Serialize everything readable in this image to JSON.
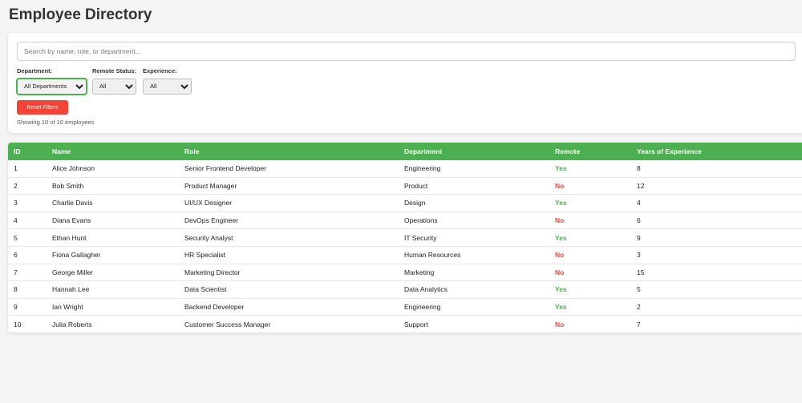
{
  "page": {
    "title": "Employee Directory"
  },
  "search": {
    "placeholder": "Search by name, role, or department..."
  },
  "filters": {
    "department": {
      "label": "Department:",
      "selected": "All Departments"
    },
    "remote": {
      "label": "Remote Status:",
      "selected": "All"
    },
    "experience": {
      "label": "Experience:",
      "selected": "All"
    }
  },
  "reset_button": {
    "label": "Reset Filters"
  },
  "results_count": "Showing 10 of 10 employees",
  "colors": {
    "accent": "#4caf50",
    "danger": "#f44336"
  },
  "table": {
    "columns": [
      "ID",
      "Name",
      "Role",
      "Department",
      "Remote",
      "Years of Experience"
    ],
    "rows": [
      {
        "id": "1",
        "name": "Alice Johnson",
        "role": "Senior Frontend Developer",
        "department": "Engineering",
        "remote": "Yes",
        "experience": "8"
      },
      {
        "id": "2",
        "name": "Bob Smith",
        "role": "Product Manager",
        "department": "Product",
        "remote": "No",
        "experience": "12"
      },
      {
        "id": "3",
        "name": "Charlie Davis",
        "role": "UI/UX Designer",
        "department": "Design",
        "remote": "Yes",
        "experience": "4"
      },
      {
        "id": "4",
        "name": "Diana Evans",
        "role": "DevOps Engineer",
        "department": "Operations",
        "remote": "No",
        "experience": "6"
      },
      {
        "id": "5",
        "name": "Ethan Hunt",
        "role": "Security Analyst",
        "department": "IT Security",
        "remote": "Yes",
        "experience": "9"
      },
      {
        "id": "6",
        "name": "Fiona Gallagher",
        "role": "HR Specialist",
        "department": "Human Resources",
        "remote": "No",
        "experience": "3"
      },
      {
        "id": "7",
        "name": "George Miller",
        "role": "Marketing Director",
        "department": "Marketing",
        "remote": "No",
        "experience": "15"
      },
      {
        "id": "8",
        "name": "Hannah Lee",
        "role": "Data Scientist",
        "department": "Data Analytics",
        "remote": "Yes",
        "experience": "5"
      },
      {
        "id": "9",
        "name": "Ian Wright",
        "role": "Backend Developer",
        "department": "Engineering",
        "remote": "Yes",
        "experience": "2"
      },
      {
        "id": "10",
        "name": "Julia Roberts",
        "role": "Customer Success Manager",
        "department": "Support",
        "remote": "No",
        "experience": "7"
      }
    ]
  }
}
